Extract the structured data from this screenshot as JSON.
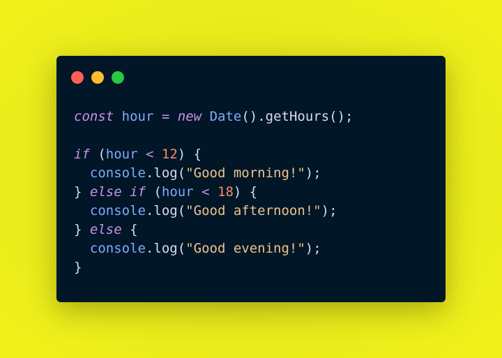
{
  "window": {
    "controls": [
      {
        "name": "close",
        "color": "#ff5f57"
      },
      {
        "name": "minimize",
        "color": "#febc2e"
      },
      {
        "name": "maximize",
        "color": "#28c840"
      }
    ]
  },
  "code": {
    "language": "javascript",
    "lines": [
      [
        [
          "kw-it",
          "const"
        ],
        [
          "punc",
          " "
        ],
        [
          "var",
          "hour"
        ],
        [
          "punc",
          " "
        ],
        [
          "op",
          "="
        ],
        [
          "punc",
          " "
        ],
        [
          "kw-it",
          "new"
        ],
        [
          "punc",
          " "
        ],
        [
          "cls",
          "Date"
        ],
        [
          "punc",
          "()."
        ],
        [
          "fn",
          "getHours"
        ],
        [
          "punc",
          "();"
        ]
      ],
      [],
      [
        [
          "kw-it",
          "if"
        ],
        [
          "punc",
          " ("
        ],
        [
          "var",
          "hour"
        ],
        [
          "punc",
          " "
        ],
        [
          "op",
          "<"
        ],
        [
          "punc",
          " "
        ],
        [
          "num",
          "12"
        ],
        [
          "punc",
          ") {"
        ]
      ],
      [
        [
          "punc",
          "  "
        ],
        [
          "obj",
          "console"
        ],
        [
          "punc",
          "."
        ],
        [
          "fn",
          "log"
        ],
        [
          "punc",
          "("
        ],
        [
          "str",
          "\"Good morning!\""
        ],
        [
          "punc",
          ");"
        ]
      ],
      [
        [
          "punc",
          "} "
        ],
        [
          "kw-it",
          "else"
        ],
        [
          "punc",
          " "
        ],
        [
          "kw-it",
          "if"
        ],
        [
          "punc",
          " ("
        ],
        [
          "var",
          "hour"
        ],
        [
          "punc",
          " "
        ],
        [
          "op",
          "<"
        ],
        [
          "punc",
          " "
        ],
        [
          "num",
          "18"
        ],
        [
          "punc",
          ") {"
        ]
      ],
      [
        [
          "punc",
          "  "
        ],
        [
          "obj",
          "console"
        ],
        [
          "punc",
          "."
        ],
        [
          "fn",
          "log"
        ],
        [
          "punc",
          "("
        ],
        [
          "str",
          "\"Good afternoon!\""
        ],
        [
          "punc",
          ");"
        ]
      ],
      [
        [
          "punc",
          "} "
        ],
        [
          "kw-it",
          "else"
        ],
        [
          "punc",
          " {"
        ]
      ],
      [
        [
          "punc",
          "  "
        ],
        [
          "obj",
          "console"
        ],
        [
          "punc",
          "."
        ],
        [
          "fn",
          "log"
        ],
        [
          "punc",
          "("
        ],
        [
          "str",
          "\"Good evening!\""
        ],
        [
          "punc",
          ");"
        ]
      ],
      [
        [
          "punc",
          "}"
        ]
      ]
    ]
  }
}
